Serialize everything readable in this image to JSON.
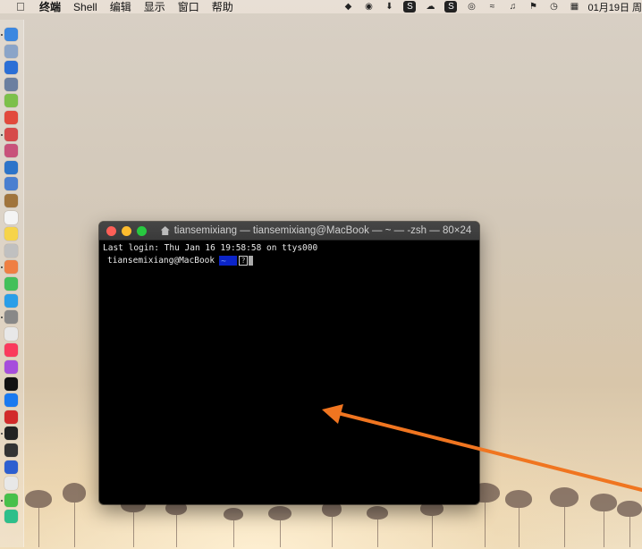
{
  "menubar": {
    "apple_icon": "apple-logo",
    "items": [
      "终端",
      "Shell",
      "编辑",
      "显示",
      "窗口",
      "帮助"
    ],
    "status_icons": [
      "vpn-shield-icon",
      "chrome-like-icon",
      "download-icon",
      "s-icon",
      "ghost-icon",
      "s-square-icon",
      "globe-icon",
      "wifi-icon",
      "music-note-icon",
      "flag-icon",
      "clock-icon",
      "calendar-icon"
    ],
    "date": "01月19日 周"
  },
  "dock": {
    "icons": [
      "finder",
      "launchpad",
      "safari",
      "rocket",
      "android",
      "chrome",
      "app-red",
      "app-pink",
      "app-blue",
      "preview",
      "notes-brown",
      "calendar",
      "notes-yellow",
      "photos-viewer",
      "photos",
      "messages",
      "wechat",
      "settings",
      "itunes",
      "music",
      "podcasts",
      "apple-tv",
      "app-store",
      "vivaldi",
      "terminal",
      "terminal-2",
      "vpn",
      "yandex",
      "wechat-green",
      "green-app"
    ],
    "colors": [
      "#3b87e0",
      "#8aa4c8",
      "#2b6fd6",
      "#6b7fa0",
      "#7cc04a",
      "#e24a3c",
      "#d64a4a",
      "#c8527a",
      "#2d74c9",
      "#4a7fd0",
      "#a0743c",
      "#f4f4f4",
      "#f6d44a",
      "#c0c0c0",
      "#ef7f43",
      "#43c05a",
      "#2a9ee8",
      "#888888",
      "#e8e8e8",
      "#fa3b5c",
      "#a64ddc",
      "#111111",
      "#1a7af0",
      "#d22a2a",
      "#222222",
      "#333333",
      "#2d5fd0",
      "#e8e8e8",
      "#47c04a",
      "#2dbf8a"
    ]
  },
  "terminal": {
    "title": "tiansemixiang — tiansemixiang@MacBook — ~ — -zsh — 80×24",
    "last_login": "Last login: Thu Jan 16 19:58:58 on ttys000",
    "prompt_user": "tiansemixiang@MacBook",
    "prompt_dir": "~",
    "cursor_glyph": "?"
  },
  "annotation": {
    "arrow_color": "#f07520"
  }
}
